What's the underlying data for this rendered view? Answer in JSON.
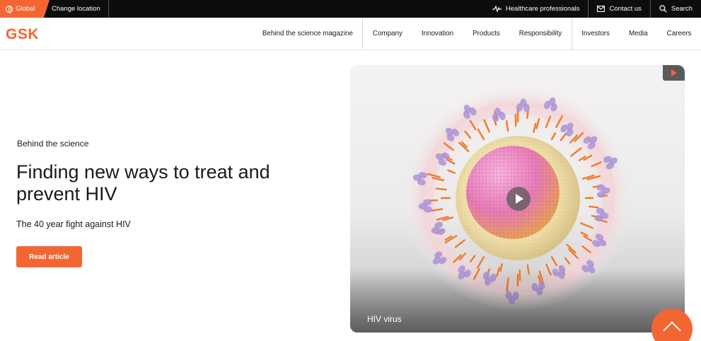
{
  "topbar": {
    "global_label": "Global",
    "change_location_label": "Change location",
    "utility_links": [
      {
        "label": "Healthcare professionals",
        "icon": "pulse-icon"
      },
      {
        "label": "Contact us",
        "icon": "envelope-icon"
      },
      {
        "label": "Search",
        "icon": "search-icon"
      }
    ]
  },
  "nav": {
    "logo": "GSK",
    "links": [
      "Behind the science magazine",
      "Company",
      "Innovation",
      "Products",
      "Responsibility",
      "Investors",
      "Media",
      "Careers"
    ]
  },
  "hero": {
    "eyebrow": "Behind the science",
    "title": "Finding new ways to treat and prevent HIV",
    "subtitle": "The 40 year fight against HIV",
    "cta_label": "Read article",
    "media_caption": "HIV virus"
  },
  "colors": {
    "brand_orange": "#f36633",
    "topbar_bg": "#0d0d0d",
    "text": "#1a1a1a"
  }
}
